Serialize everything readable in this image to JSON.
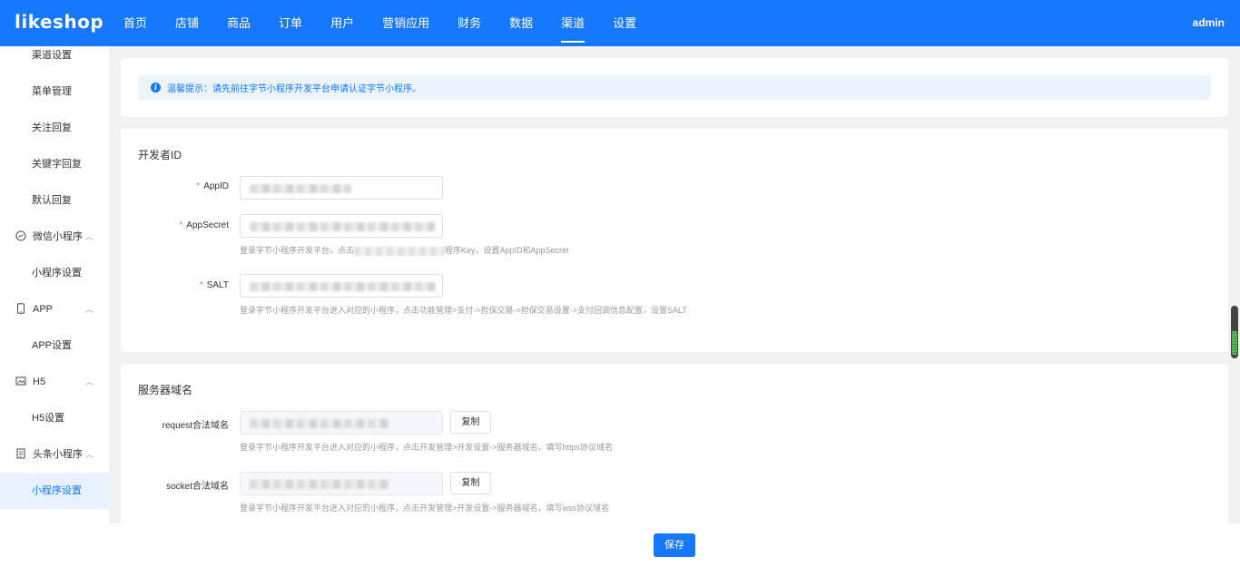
{
  "header": {
    "logo": "likeshop",
    "nav": [
      "首页",
      "店铺",
      "商品",
      "订单",
      "用户",
      "营销应用",
      "财务",
      "数据",
      "渠道",
      "设置"
    ],
    "active_nav": "渠道",
    "user": "admin"
  },
  "sidebar": {
    "items": [
      {
        "label": "渠道设置",
        "type": "sub"
      },
      {
        "label": "菜单管理",
        "type": "sub"
      },
      {
        "label": "关注回复",
        "type": "sub"
      },
      {
        "label": "关键字回复",
        "type": "sub"
      },
      {
        "label": "默认回复",
        "type": "sub"
      },
      {
        "label": "微信小程序",
        "type": "group",
        "icon": "wechat-miniprogram-icon"
      },
      {
        "label": "小程序设置",
        "type": "sub"
      },
      {
        "label": "APP",
        "type": "group",
        "icon": "phone-icon"
      },
      {
        "label": "APP设置",
        "type": "sub"
      },
      {
        "label": "H5",
        "type": "group",
        "icon": "image-icon"
      },
      {
        "label": "H5设置",
        "type": "sub"
      },
      {
        "label": "头条小程序",
        "type": "group",
        "icon": "document-icon"
      },
      {
        "label": "小程序设置",
        "type": "sub",
        "active": true
      }
    ]
  },
  "alert": {
    "text": "温馨提示：请先前往字节小程序开发平台申请认证字节小程序。"
  },
  "developer": {
    "title": "开发者ID",
    "appid_label": "AppID",
    "appsecret_label": "AppSecret",
    "appsecret_hint_prefix": "登录字节小程序开发平台，点击",
    "appsecret_hint_suffix": "程序Key，设置AppID和AppSecret",
    "salt_label": "SALT",
    "salt_hint": "登录字节小程序开发平台进入对应的小程序，点击功能管理>支付->担保交易->担保交易设置->支付回调信息配置，设置SALT"
  },
  "server": {
    "title": "服务器域名",
    "request_label": "request合法域名",
    "request_hint": "登录字节小程序开发平台进入对应的小程序，点击开发管理>开发设置->服务器域名，填写https协议域名",
    "socket_label": "socket合法域名",
    "socket_hint": "登录字节小程序开发平台进入对应的小程序，点击开发管理>开发设置->服务器域名，填写wss协议域名",
    "copy_label": "复制"
  },
  "footer": {
    "save_label": "保存"
  },
  "colors": {
    "primary": "#1677ff",
    "required": "#f56c6c"
  }
}
